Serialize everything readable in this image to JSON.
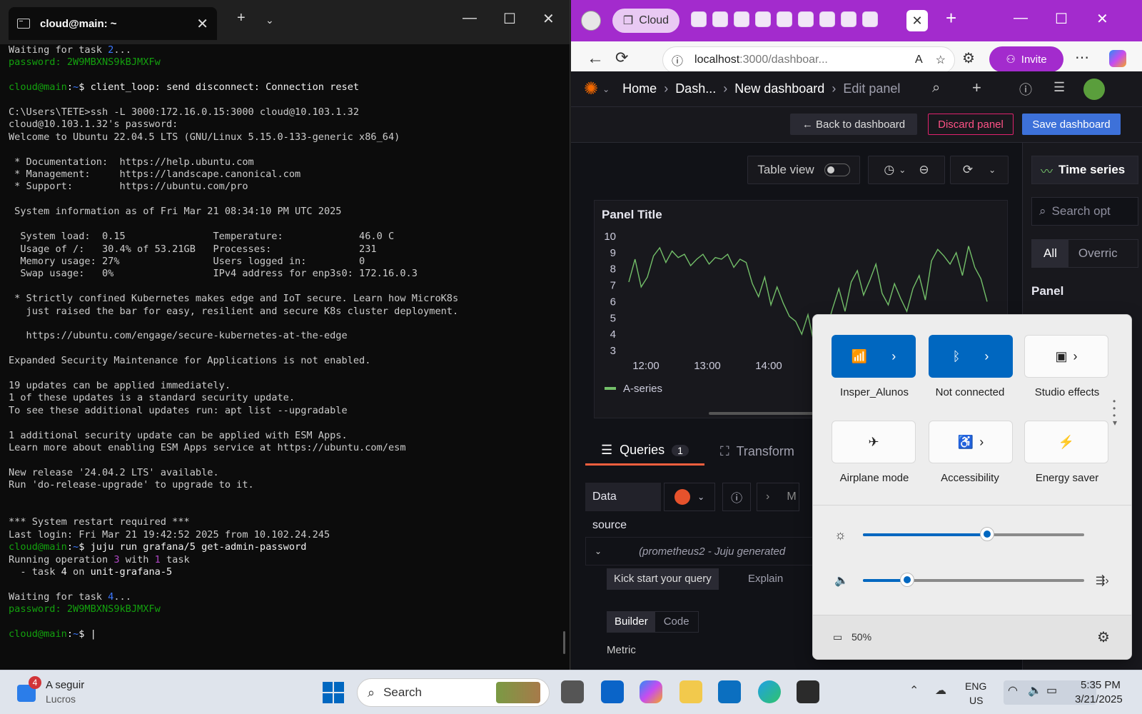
{
  "terminal": {
    "tab_title": "cloud@main: ~",
    "lines": [
      [
        {
          "t": "Waiting for task ",
          "c": ""
        },
        {
          "t": "2",
          "c": "b"
        },
        {
          "t": "...",
          "c": ""
        }
      ],
      [
        {
          "t": "password: 2W9MBXNS9kBJMXFw",
          "c": "g"
        }
      ],
      [
        {
          "t": "",
          "c": ""
        }
      ],
      [
        {
          "t": "cloud@main",
          "c": "g"
        },
        {
          "t": ":",
          "c": "w"
        },
        {
          "t": "~",
          "c": "b"
        },
        {
          "t": "$ client_loop: send disconnect: Connection reset",
          "c": "w"
        }
      ],
      [
        {
          "t": "",
          "c": ""
        }
      ],
      [
        {
          "t": "C:\\Users\\TETE>ssh -L 3000:172.16.0.15:3000 cloud@10.103.1.32",
          "c": ""
        }
      ],
      [
        {
          "t": "cloud@10.103.1.32's password:",
          "c": ""
        }
      ],
      [
        {
          "t": "Welcome to Ubuntu 22.04.5 LTS (GNU/Linux 5.15.0-133-generic x86_64)",
          "c": ""
        }
      ],
      [
        {
          "t": "",
          "c": ""
        }
      ],
      [
        {
          "t": " * Documentation:  https://help.ubuntu.com",
          "c": ""
        }
      ],
      [
        {
          "t": " * Management:     https://landscape.canonical.com",
          "c": ""
        }
      ],
      [
        {
          "t": " * Support:        https://ubuntu.com/pro",
          "c": ""
        }
      ],
      [
        {
          "t": "",
          "c": ""
        }
      ],
      [
        {
          "t": " System information as of Fri Mar 21 08:34:10 PM UTC 2025",
          "c": ""
        }
      ],
      [
        {
          "t": "",
          "c": ""
        }
      ],
      [
        {
          "t": "  System load:  0.15               Temperature:             46.0 C",
          "c": ""
        }
      ],
      [
        {
          "t": "  Usage of /:   30.4% of 53.21GB   Processes:               231",
          "c": ""
        }
      ],
      [
        {
          "t": "  Memory usage: 27%                Users logged in:         0",
          "c": ""
        }
      ],
      [
        {
          "t": "  Swap usage:   0%                 IPv4 address for enp3s0: 172.16.0.3",
          "c": ""
        }
      ],
      [
        {
          "t": "",
          "c": ""
        }
      ],
      [
        {
          "t": " * Strictly confined Kubernetes makes edge and IoT secure. Learn how MicroK8s",
          "c": ""
        }
      ],
      [
        {
          "t": "   just raised the bar for easy, resilient and secure K8s cluster deployment.",
          "c": ""
        }
      ],
      [
        {
          "t": "",
          "c": ""
        }
      ],
      [
        {
          "t": "   https://ubuntu.com/engage/secure-kubernetes-at-the-edge",
          "c": ""
        }
      ],
      [
        {
          "t": "",
          "c": ""
        }
      ],
      [
        {
          "t": "Expanded Security Maintenance for Applications is not enabled.",
          "c": ""
        }
      ],
      [
        {
          "t": "",
          "c": ""
        }
      ],
      [
        {
          "t": "19 updates can be applied immediately.",
          "c": ""
        }
      ],
      [
        {
          "t": "1 of these updates is a standard security update.",
          "c": ""
        }
      ],
      [
        {
          "t": "To see these additional updates run: apt list --upgradable",
          "c": ""
        }
      ],
      [
        {
          "t": "",
          "c": ""
        }
      ],
      [
        {
          "t": "1 additional security update can be applied with ESM Apps.",
          "c": ""
        }
      ],
      [
        {
          "t": "Learn more about enabling ESM Apps service at https://ubuntu.com/esm",
          "c": ""
        }
      ],
      [
        {
          "t": "",
          "c": ""
        }
      ],
      [
        {
          "t": "New release '24.04.2 LTS' available.",
          "c": ""
        }
      ],
      [
        {
          "t": "Run 'do-release-upgrade' to upgrade to it.",
          "c": ""
        }
      ],
      [
        {
          "t": "",
          "c": ""
        }
      ],
      [
        {
          "t": "",
          "c": ""
        }
      ],
      [
        {
          "t": "*** System restart required ***",
          "c": ""
        }
      ],
      [
        {
          "t": "Last login: Fri Mar 21 19:42:52 2025 from 10.102.24.245",
          "c": ""
        }
      ],
      [
        {
          "t": "cloud@main",
          "c": "g"
        },
        {
          "t": ":",
          "c": "w"
        },
        {
          "t": "~",
          "c": "b"
        },
        {
          "t": "$ juju run grafana/5 get-admin-password",
          "c": "w"
        }
      ],
      [
        {
          "t": "Running operation ",
          "c": ""
        },
        {
          "t": "3",
          "c": "m"
        },
        {
          "t": " with ",
          "c": ""
        },
        {
          "t": "1",
          "c": "m"
        },
        {
          "t": " task",
          "c": ""
        }
      ],
      [
        {
          "t": "  - task ",
          "c": ""
        },
        {
          "t": "4",
          "c": "w"
        },
        {
          "t": " on ",
          "c": ""
        },
        {
          "t": "unit-grafana-5",
          "c": "w"
        }
      ],
      [
        {
          "t": "",
          "c": ""
        }
      ],
      [
        {
          "t": "Waiting for task ",
          "c": ""
        },
        {
          "t": "4",
          "c": "b"
        },
        {
          "t": "...",
          "c": ""
        }
      ],
      [
        {
          "t": "password: 2W9MBXNS9kBJMXFw",
          "c": "g"
        }
      ],
      [
        {
          "t": "",
          "c": ""
        }
      ],
      [
        {
          "t": "cloud@main",
          "c": "g"
        },
        {
          "t": ":",
          "c": "w"
        },
        {
          "t": "~",
          "c": "b"
        },
        {
          "t": "$ ",
          "c": "w"
        },
        {
          "t": "|",
          "c": "w"
        }
      ]
    ]
  },
  "browser": {
    "profile_pill": "Cloud",
    "url_host": "localhost",
    "url_path": ":3000/dashboar...",
    "invite_label": "Invite"
  },
  "grafana": {
    "breadcrumbs": [
      "Home",
      "Dash...",
      "New dashboard",
      "Edit panel"
    ],
    "back_label": "← Back to dashboard",
    "discard_label": "Discard panel",
    "save_label": "Save dashboard",
    "table_view_label": "Table view",
    "panel_title": "Panel Title",
    "viz_type": "Time series",
    "search_options_placeholder": "Search opt",
    "tabs_all": "All",
    "tabs_overrides": "Overric",
    "panel_options_label": "Panel",
    "queries_tab": "Queries",
    "queries_count": "1",
    "transform_tab": "Transform",
    "data_source_label": "Data source",
    "query_header": "(prometheus2 - Juju generated",
    "kick_start_label": "Kick start your query",
    "explain_label": "Explain",
    "builder_label": "Builder",
    "code_label": "Code",
    "metric_label": "Metric",
    "m_label": "M"
  },
  "chart_data": {
    "type": "line",
    "title": "Panel Title",
    "x_ticks": [
      "12:00",
      "13:00",
      "14:00"
    ],
    "y_ticks": [
      3,
      4,
      5,
      6,
      7,
      8,
      9,
      10
    ],
    "ylim": [
      3,
      10
    ],
    "series": [
      {
        "name": "A-series",
        "color": "#73bf69",
        "values": [
          7.2,
          8.6,
          6.9,
          7.5,
          8.8,
          9.3,
          8.4,
          9.1,
          8.7,
          8.9,
          8.2,
          8.6,
          8.9,
          8.3,
          8.7,
          8.6,
          8.9,
          8.1,
          8.6,
          8.4,
          7.1,
          6.3,
          7.5,
          5.8,
          6.9,
          5.9,
          5.1,
          4.8,
          4.0,
          5.2,
          3.4,
          5.0,
          4.3,
          5.6,
          6.8,
          5.4,
          7.2,
          7.9,
          6.4,
          7.3,
          8.3,
          6.5,
          5.8,
          7.1,
          6.2,
          5.4,
          6.8,
          7.6,
          6.1,
          8.5,
          9.2,
          8.8,
          8.3,
          9.0,
          7.6,
          9.4,
          8.1,
          7.4,
          6.0
        ]
      }
    ]
  },
  "quick_settings": {
    "wifi_label": "Insper_Alunos",
    "bluetooth_label": "Not connected",
    "studio_label": "Studio effects",
    "airplane_label": "Airplane mode",
    "accessibility_label": "Accessibility",
    "energy_label": "Energy saver",
    "brightness_level": 0.56,
    "volume_level": 0.2,
    "battery_label": "50%"
  },
  "taskbar": {
    "widget_title": "A seguir",
    "widget_sub": "Lucros",
    "widget_badge": "4",
    "search_label": "Search",
    "lang_top": "ENG",
    "lang_bottom": "US",
    "time": "5:35 PM",
    "date": "3/21/2025"
  }
}
